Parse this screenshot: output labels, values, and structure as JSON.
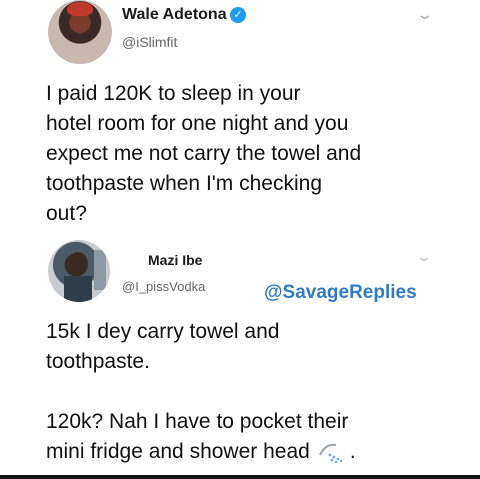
{
  "tweet1": {
    "name": "Wale Adetona",
    "handle": "@iSlimfit",
    "text": "I paid 120K to sleep in your\nhotel room for one night and you\nexpect me not carry the towel and\ntoothpaste when I'm checking\nout?",
    "verified": true
  },
  "tweet2": {
    "name": "Mazi Ibe",
    "handle": "@I_pissVodka",
    "text_line_a": "15k I dey carry towel and\ntoothpaste.\n\n120k? Nah I have to pocket their\nmini fridge and shower head",
    "text_end": "."
  },
  "watermark": "@SavageReplies",
  "colors": {
    "verified": "#1d9bf0",
    "watermark": "#2e7cc5"
  },
  "icons": {
    "caret": "chevron-down-icon",
    "shower": "shower-head-icon"
  }
}
